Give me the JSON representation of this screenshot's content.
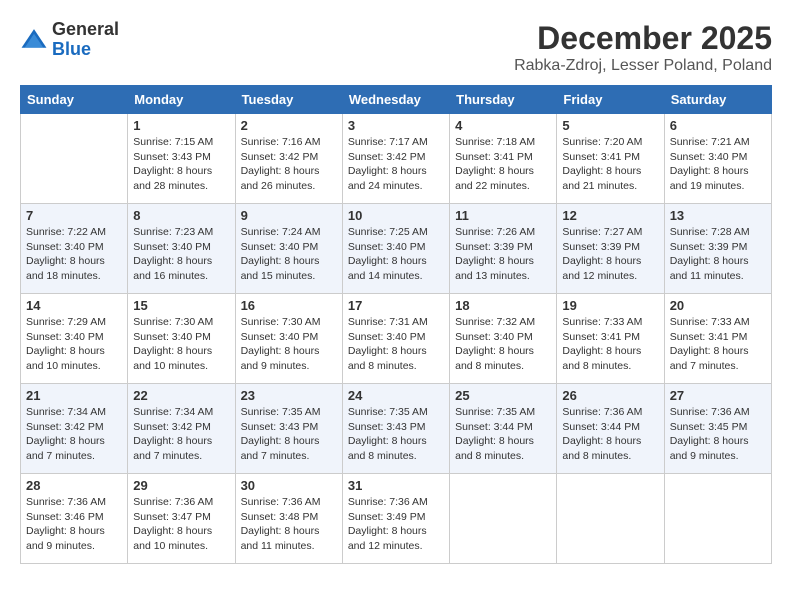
{
  "logo": {
    "general": "General",
    "blue": "Blue"
  },
  "header": {
    "month": "December 2025",
    "location": "Rabka-Zdroj, Lesser Poland, Poland"
  },
  "days_of_week": [
    "Sunday",
    "Monday",
    "Tuesday",
    "Wednesday",
    "Thursday",
    "Friday",
    "Saturday"
  ],
  "weeks": [
    [
      {
        "day": "",
        "info": ""
      },
      {
        "day": "1",
        "info": "Sunrise: 7:15 AM\nSunset: 3:43 PM\nDaylight: 8 hours\nand 28 minutes."
      },
      {
        "day": "2",
        "info": "Sunrise: 7:16 AM\nSunset: 3:42 PM\nDaylight: 8 hours\nand 26 minutes."
      },
      {
        "day": "3",
        "info": "Sunrise: 7:17 AM\nSunset: 3:42 PM\nDaylight: 8 hours\nand 24 minutes."
      },
      {
        "day": "4",
        "info": "Sunrise: 7:18 AM\nSunset: 3:41 PM\nDaylight: 8 hours\nand 22 minutes."
      },
      {
        "day": "5",
        "info": "Sunrise: 7:20 AM\nSunset: 3:41 PM\nDaylight: 8 hours\nand 21 minutes."
      },
      {
        "day": "6",
        "info": "Sunrise: 7:21 AM\nSunset: 3:40 PM\nDaylight: 8 hours\nand 19 minutes."
      }
    ],
    [
      {
        "day": "7",
        "info": "Sunrise: 7:22 AM\nSunset: 3:40 PM\nDaylight: 8 hours\nand 18 minutes."
      },
      {
        "day": "8",
        "info": "Sunrise: 7:23 AM\nSunset: 3:40 PM\nDaylight: 8 hours\nand 16 minutes."
      },
      {
        "day": "9",
        "info": "Sunrise: 7:24 AM\nSunset: 3:40 PM\nDaylight: 8 hours\nand 15 minutes."
      },
      {
        "day": "10",
        "info": "Sunrise: 7:25 AM\nSunset: 3:40 PM\nDaylight: 8 hours\nand 14 minutes."
      },
      {
        "day": "11",
        "info": "Sunrise: 7:26 AM\nSunset: 3:39 PM\nDaylight: 8 hours\nand 13 minutes."
      },
      {
        "day": "12",
        "info": "Sunrise: 7:27 AM\nSunset: 3:39 PM\nDaylight: 8 hours\nand 12 minutes."
      },
      {
        "day": "13",
        "info": "Sunrise: 7:28 AM\nSunset: 3:39 PM\nDaylight: 8 hours\nand 11 minutes."
      }
    ],
    [
      {
        "day": "14",
        "info": "Sunrise: 7:29 AM\nSunset: 3:40 PM\nDaylight: 8 hours\nand 10 minutes."
      },
      {
        "day": "15",
        "info": "Sunrise: 7:30 AM\nSunset: 3:40 PM\nDaylight: 8 hours\nand 10 minutes."
      },
      {
        "day": "16",
        "info": "Sunrise: 7:30 AM\nSunset: 3:40 PM\nDaylight: 8 hours\nand 9 minutes."
      },
      {
        "day": "17",
        "info": "Sunrise: 7:31 AM\nSunset: 3:40 PM\nDaylight: 8 hours\nand 8 minutes."
      },
      {
        "day": "18",
        "info": "Sunrise: 7:32 AM\nSunset: 3:40 PM\nDaylight: 8 hours\nand 8 minutes."
      },
      {
        "day": "19",
        "info": "Sunrise: 7:33 AM\nSunset: 3:41 PM\nDaylight: 8 hours\nand 8 minutes."
      },
      {
        "day": "20",
        "info": "Sunrise: 7:33 AM\nSunset: 3:41 PM\nDaylight: 8 hours\nand 7 minutes."
      }
    ],
    [
      {
        "day": "21",
        "info": "Sunrise: 7:34 AM\nSunset: 3:42 PM\nDaylight: 8 hours\nand 7 minutes."
      },
      {
        "day": "22",
        "info": "Sunrise: 7:34 AM\nSunset: 3:42 PM\nDaylight: 8 hours\nand 7 minutes."
      },
      {
        "day": "23",
        "info": "Sunrise: 7:35 AM\nSunset: 3:43 PM\nDaylight: 8 hours\nand 7 minutes."
      },
      {
        "day": "24",
        "info": "Sunrise: 7:35 AM\nSunset: 3:43 PM\nDaylight: 8 hours\nand 8 minutes."
      },
      {
        "day": "25",
        "info": "Sunrise: 7:35 AM\nSunset: 3:44 PM\nDaylight: 8 hours\nand 8 minutes."
      },
      {
        "day": "26",
        "info": "Sunrise: 7:36 AM\nSunset: 3:44 PM\nDaylight: 8 hours\nand 8 minutes."
      },
      {
        "day": "27",
        "info": "Sunrise: 7:36 AM\nSunset: 3:45 PM\nDaylight: 8 hours\nand 9 minutes."
      }
    ],
    [
      {
        "day": "28",
        "info": "Sunrise: 7:36 AM\nSunset: 3:46 PM\nDaylight: 8 hours\nand 9 minutes."
      },
      {
        "day": "29",
        "info": "Sunrise: 7:36 AM\nSunset: 3:47 PM\nDaylight: 8 hours\nand 10 minutes."
      },
      {
        "day": "30",
        "info": "Sunrise: 7:36 AM\nSunset: 3:48 PM\nDaylight: 8 hours\nand 11 minutes."
      },
      {
        "day": "31",
        "info": "Sunrise: 7:36 AM\nSunset: 3:49 PM\nDaylight: 8 hours\nand 12 minutes."
      },
      {
        "day": "",
        "info": ""
      },
      {
        "day": "",
        "info": ""
      },
      {
        "day": "",
        "info": ""
      }
    ]
  ]
}
